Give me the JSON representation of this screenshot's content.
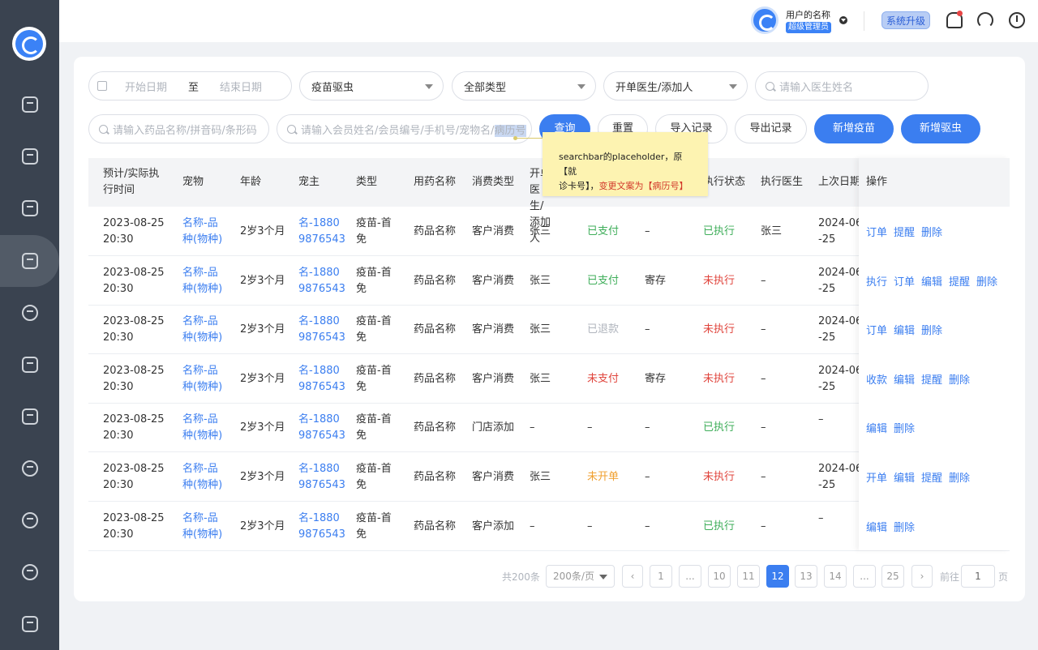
{
  "user": {
    "name": "用户的名称",
    "role": "超级管理员",
    "upgrade": "系统升级"
  },
  "filters": {
    "start_date": "开始日期",
    "to": "至",
    "end_date": "结束日期",
    "category": "疫苗驱虫",
    "type": "全部类型",
    "doctor_select": "开单医生/添加人",
    "doctor_search": "请输入医生姓名",
    "drug_search": "请输入药品名称/拼音码/条形码",
    "member_search_prefix": "请输入会员姓名/会员编号/手机号/宠物名/",
    "member_search_highlight": "病历号"
  },
  "buttons": {
    "query": "查询",
    "reset": "重置",
    "import": "导入记录",
    "export": "导出记录",
    "add_vaccine": "新增疫苗",
    "add_deworm": "新增驱虫"
  },
  "tooltip": {
    "line1": "searchbar的placeholder，原【就",
    "line2a": "诊卡号】，",
    "line2b": "变更文案为【病历号】"
  },
  "table": {
    "headers": {
      "time": "预计/实际执行时间",
      "pet": "宠物",
      "age": "年龄",
      "owner": "宠主",
      "type": "类型",
      "drug": "用药名称",
      "consume": "消费类型",
      "doctor": "开单医生/添加人",
      "status": "执行状态",
      "exec_doctor": "执行医生",
      "last_date": "上次日期",
      "ops": "操作"
    },
    "rows": [
      {
        "t1": "2023-08-25",
        "t2": "20:30",
        "p1": "名称-品",
        "p2": "种(物种)",
        "age": "2岁3个月",
        "o1": "名-1880",
        "o2": "9876543",
        "ty1": "疫苗-首",
        "ty2": "免",
        "drug": "药品名称",
        "consume": "客户消费",
        "doctor": "张三",
        "pay": "已支付",
        "store": "–",
        "exec": "已执行",
        "ed": "张三",
        "d1": "2024-06",
        "d2": "-25",
        "ops": [
          "订单",
          "提醒",
          "删除"
        ]
      },
      {
        "t1": "2023-08-25",
        "t2": "20:30",
        "p1": "名称-品",
        "p2": "种(物种)",
        "age": "2岁3个月",
        "o1": "名-1880",
        "o2": "9876543",
        "ty1": "疫苗-首",
        "ty2": "免",
        "drug": "药品名称",
        "consume": "客户消费",
        "doctor": "张三",
        "pay": "已支付",
        "store": "寄存",
        "exec": "未执行",
        "ed": "–",
        "d1": "2024-06",
        "d2": "-25",
        "ops": [
          "执行",
          "订单",
          "编辑",
          "提醒",
          "删除"
        ]
      },
      {
        "t1": "2023-08-25",
        "t2": "20:30",
        "p1": "名称-品",
        "p2": "种(物种)",
        "age": "2岁3个月",
        "o1": "名-1880",
        "o2": "9876543",
        "ty1": "疫苗-首",
        "ty2": "免",
        "drug": "药品名称",
        "consume": "客户消费",
        "doctor": "张三",
        "pay": "已退款",
        "store": "–",
        "exec": "未执行",
        "ed": "–",
        "d1": "2024-06",
        "d2": "-25",
        "ops": [
          "订单",
          "编辑",
          "删除"
        ]
      },
      {
        "t1": "2023-08-25",
        "t2": "20:30",
        "p1": "名称-品",
        "p2": "种(物种)",
        "age": "2岁3个月",
        "o1": "名-1880",
        "o2": "9876543",
        "ty1": "疫苗-首",
        "ty2": "免",
        "drug": "药品名称",
        "consume": "客户消费",
        "doctor": "张三",
        "pay": "未支付",
        "store": "寄存",
        "exec": "未执行",
        "ed": "–",
        "d1": "2024-06",
        "d2": "-25",
        "ops": [
          "收款",
          "编辑",
          "提醒",
          "删除"
        ]
      },
      {
        "t1": "2023-08-25",
        "t2": "20:30",
        "p1": "名称-品",
        "p2": "种(物种)",
        "age": "2岁3个月",
        "o1": "名-1880",
        "o2": "9876543",
        "ty1": "疫苗-首",
        "ty2": "免",
        "drug": "药品名称",
        "consume": "门店添加",
        "doctor": "–",
        "pay": "–",
        "store": "–",
        "exec": "已执行",
        "ed": "–",
        "d1": "–",
        "d2": "",
        "ops": [
          "编辑",
          "删除"
        ]
      },
      {
        "t1": "2023-08-25",
        "t2": "20:30",
        "p1": "名称-品",
        "p2": "种(物种)",
        "age": "2岁3个月",
        "o1": "名-1880",
        "o2": "9876543",
        "ty1": "疫苗-首",
        "ty2": "免",
        "drug": "药品名称",
        "consume": "客户消费",
        "doctor": "张三",
        "pay": "未开单",
        "store": "–",
        "exec": "未执行",
        "ed": "–",
        "d1": "2024-06",
        "d2": "-25",
        "ops": [
          "开单",
          "编辑",
          "提醒",
          "删除"
        ]
      },
      {
        "t1": "2023-08-25",
        "t2": "20:30",
        "p1": "名称-品",
        "p2": "种(物种)",
        "age": "2岁3个月",
        "o1": "名-1880",
        "o2": "9876543",
        "ty1": "疫苗-首",
        "ty2": "免",
        "drug": "药品名称",
        "consume": "客户添加",
        "doctor": "–",
        "pay": "–",
        "store": "–",
        "exec": "已执行",
        "ed": "–",
        "d1": "–",
        "d2": "",
        "ops": [
          "编辑",
          "删除"
        ]
      }
    ]
  },
  "pagination": {
    "total": "共200条",
    "page_size": "200条/页",
    "pages": [
      "1",
      "...",
      "10",
      "11",
      "12",
      "13",
      "14",
      "...",
      "25"
    ],
    "current": "12",
    "goto_label": "前往",
    "goto_value": "1",
    "page_unit": "页"
  },
  "colors": {
    "primary": "#3b7ef0",
    "success": "#3fae5a",
    "danger": "#e0453d",
    "warning": "#f0a030",
    "sidebar": "#3a4350"
  }
}
